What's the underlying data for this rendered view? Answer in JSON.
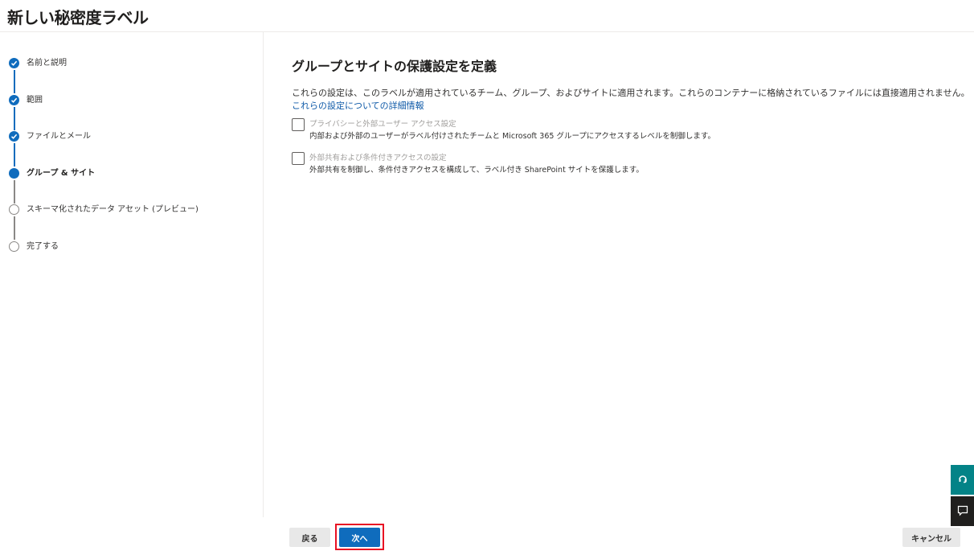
{
  "header": {
    "title": "新しい秘密度ラベル"
  },
  "steps": [
    {
      "label": "名前と説明",
      "state": "done"
    },
    {
      "label": "範囲",
      "state": "done"
    },
    {
      "label": "ファイルとメール",
      "state": "done"
    },
    {
      "label": "グループ & サイト",
      "state": "current"
    },
    {
      "label": "スキーマ化されたデータ アセット (プレビュー)",
      "state": "todo"
    },
    {
      "label": "完了する",
      "state": "todo"
    }
  ],
  "main": {
    "title": "グループとサイトの保護設定を定義",
    "description": "これらの設定は、このラベルが適用されているチーム、グループ、およびサイトに適用されます。これらのコンテナーに格納されているファイルには直接適用されません。",
    "link": "これらの設定についての詳細情報",
    "options": [
      {
        "label": "プライバシーと外部ユーザー アクセス設定",
        "description": "内部および外部のユーザーがラベル付けされたチームと Microsoft 365 グループにアクセスするレベルを制御します。",
        "checked": false
      },
      {
        "label": "外部共有および条件付きアクセスの設定",
        "description": "外部共有を制御し、条件付きアクセスを構成して、ラベル付き SharePoint サイトを保護します。",
        "checked": false
      }
    ]
  },
  "footer": {
    "back": "戻る",
    "next": "次へ",
    "cancel": "キャンセル"
  },
  "colors": {
    "accent": "#0f6cbd",
    "highlight": "#e81123",
    "help_tab": "#038387",
    "feedback_tab": "#201f1e"
  },
  "icons": {
    "help": "help-icon",
    "feedback": "feedback-icon",
    "check": "checkmark-icon"
  }
}
